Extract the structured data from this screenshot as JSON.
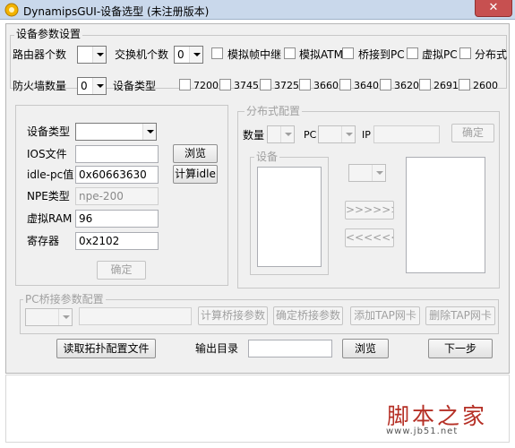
{
  "window": {
    "title": "DynamipsGUI-设备选型 (未注册版本)",
    "close_label": "✕"
  },
  "device_params": {
    "group_title": "设备参数设置",
    "router_count_label": "路由器个数",
    "router_count_value": "",
    "switch_count_label": "交换机个数",
    "switch_count_value": "0",
    "firewall_count_label": "防火墙数量",
    "firewall_count_value": "0",
    "device_type_label": "设备类型",
    "options": [
      {
        "label": "模拟帧中继",
        "checked": false
      },
      {
        "label": "模拟ATM",
        "checked": false
      },
      {
        "label": "桥接到PC",
        "checked": false
      },
      {
        "label": "虚拟PC",
        "checked": false
      },
      {
        "label": "分布式",
        "checked": false
      }
    ],
    "device_models": [
      "7200",
      "3745",
      "3725",
      "3660",
      "3640",
      "3620",
      "2691",
      "2600"
    ]
  },
  "device_config": {
    "device_type_label": "设备类型",
    "device_type_value": "",
    "ios_label": "IOS文件",
    "ios_value": "",
    "browse_label": "浏览",
    "idle_label": "idle-pc值",
    "idle_value": "0x60663630",
    "calc_idle_label": "计算idle",
    "npe_label": "NPE类型",
    "npe_value": "npe-200",
    "ram_label": "虚拟RAM",
    "ram_value": "96",
    "register_label": "寄存器",
    "register_value": "0x2102",
    "confirm_label": "确定"
  },
  "distributed": {
    "group_title": "分布式配置",
    "count_label": "数量",
    "pc_label": "PC",
    "ip_label": "IP",
    "ip_value": "",
    "confirm_label": "确定",
    "devices_group_title": "设备",
    "add_label": ">>>>>>",
    "remove_label": "<<<<<<"
  },
  "bridge": {
    "group_title": "PC桥接参数配置",
    "calc_label": "计算桥接参数",
    "confirm_label": "确定桥接参数",
    "add_tap_label": "添加TAP网卡",
    "remove_tap_label": "删除TAP网卡"
  },
  "footer": {
    "load_topology_label": "读取拓扑配置文件",
    "output_dir_label": "输出目录",
    "output_dir_value": "",
    "browse_label": "浏览",
    "next_label": "下一步"
  },
  "watermark": {
    "name": "脚本之家",
    "url": "www.jb51.net"
  }
}
